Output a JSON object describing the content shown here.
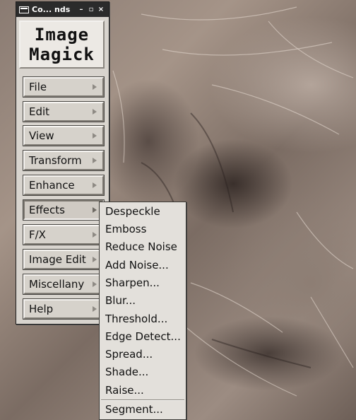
{
  "window": {
    "title": "Co... nds",
    "minimize_label": "–",
    "maximize_label": "▫",
    "close_label": "×"
  },
  "logo": {
    "line1": "Image",
    "line2": "Magick"
  },
  "menu": {
    "items": [
      {
        "label": "File"
      },
      {
        "label": "Edit"
      },
      {
        "label": "View"
      },
      {
        "label": "Transform"
      },
      {
        "label": "Enhance"
      },
      {
        "label": "Effects"
      },
      {
        "label": "F/X"
      },
      {
        "label": "Image Edit"
      },
      {
        "label": "Miscellany"
      },
      {
        "label": "Help"
      }
    ],
    "active": "Effects"
  },
  "effects_submenu": {
    "items": [
      "Despeckle",
      "Emboss",
      "Reduce Noise",
      "Add Noise...",
      "Sharpen...",
      "Blur...",
      "Threshold...",
      "Edge Detect...",
      "Spread...",
      "Shade...",
      "Raise...",
      "Segment..."
    ]
  },
  "icons": {
    "window_icon": "window-menu-icon",
    "submenu_arrow": "submenu-arrow-icon"
  },
  "colors": {
    "titlebar": "#2b2b2b",
    "panel": "#d8d4ce",
    "submenu": "#e3e0db"
  }
}
